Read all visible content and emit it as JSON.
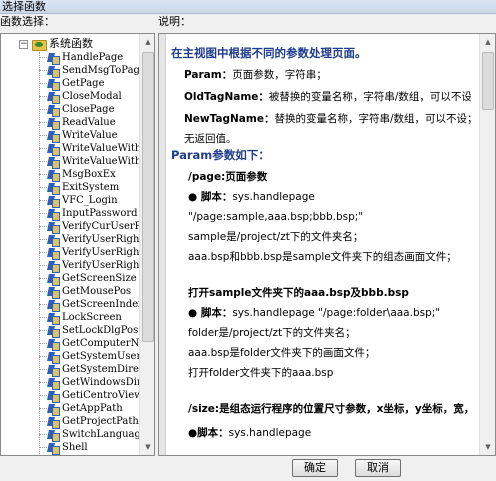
{
  "window": {
    "title": "选择函数"
  },
  "labels": {
    "left": "函数选择：",
    "right": "说明："
  },
  "tree": {
    "root": {
      "label": "系统函数",
      "expander": "−"
    },
    "items": [
      "HandlePage",
      "SendMsgToPage",
      "GetPage",
      "CloseModal",
      "ClosePage",
      "ReadValue",
      "WriteValue",
      "WriteValueWithLo",
      "WriteValueWithAc",
      "MsgBoxEx",
      "ExitSystem",
      "VFC_Login",
      "InputPassword",
      "VerifyCurUserRig",
      "VerifyUserRightU",
      "VerifyUserRightUC",
      "VerifyUserRight",
      "GetScreenSize",
      "GetMousePos",
      "GetScreenIndex",
      "LockScreen",
      "SetLockDlgPos",
      "GetComputerName",
      "GetSystemUserNam",
      "GetSystemDirecto",
      "GetWindowsDirect",
      "GetiCentroViewUs",
      "GetAppPath",
      "GetProjectPath",
      "SwitchLanguage",
      "Shell"
    ]
  },
  "description": {
    "lines": [
      {
        "text": "在主视图中根据不同的参数处理页面。",
        "style": "blue"
      },
      {
        "bold": "Param：",
        "text": "页面参数，字符串；"
      },
      {
        "bold": "OldTagName：",
        "text": "被替换的变量名称，字符串/数组，可以不设；"
      },
      {
        "bold": "NewTagName：",
        "text": "替换的变量名称，字符串/数组，可以不设；"
      },
      {
        "text": "无返回值。"
      },
      {
        "text": "Param参数如下：",
        "style": "blue"
      },
      {
        "bold": "/page:页面参数",
        "text": ""
      },
      {
        "bold": "● 脚本：",
        "text": "sys.handlepage"
      },
      {
        "text": "\"/page:sample,aaa.bsp;bbb.bsp;\""
      },
      {
        "text": "sample是/project/zt下的文件夹名；"
      },
      {
        "text": "aaa.bsp和bbb.bsp是sample文件夹下的组态画面文件；"
      },
      {
        "bold": "打开sample文件夹下的aaa.bsp及bbb.bsp",
        "text": ""
      },
      {
        "bold": "● 脚本：",
        "text": "sys.handlepage \"/page:folder\\aaa.bsp;\""
      },
      {
        "text": "folder是/project/zt下的文件夹名；"
      },
      {
        "text": "aaa.bsp是folder文件夹下的画面文件；"
      },
      {
        "text": "打开folder文件夹下的aaa.bsp"
      },
      {
        "bold": "/size:是组态运行程序的位置尺寸参数，x坐标，y坐标，宽，高",
        "text": ""
      },
      {
        "bold": "●脚本：",
        "text": "sys.handlepage"
      }
    ]
  },
  "buttons": {
    "ok": "确定",
    "cancel": "取消"
  },
  "colors": {
    "heading": "#1f3c8e",
    "border": "#8a8a8a"
  }
}
